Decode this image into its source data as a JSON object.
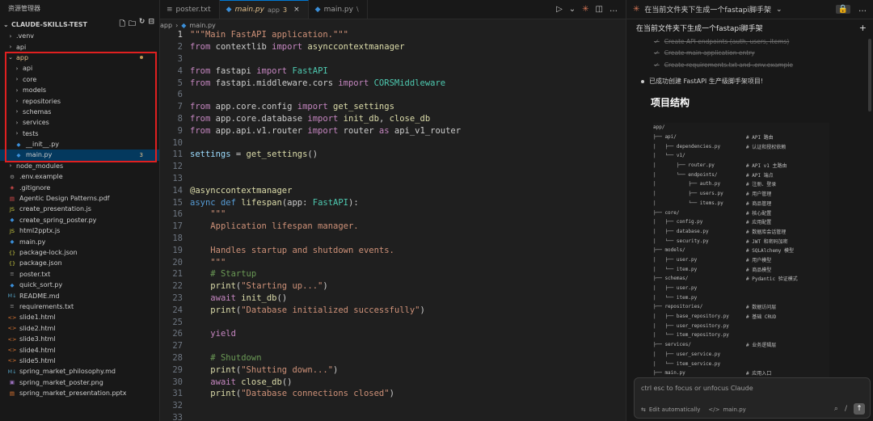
{
  "explorer": {
    "title": "资源管理器",
    "project": "CLAUDE-SKILLS-TEST",
    "items": [
      {
        "name": ".venv",
        "type": "folder",
        "depth": 0
      },
      {
        "name": "api",
        "type": "folder",
        "depth": 0
      },
      {
        "name": "app",
        "type": "folder-open",
        "depth": 0,
        "modified": true
      },
      {
        "name": "api",
        "type": "folder",
        "depth": 1
      },
      {
        "name": "core",
        "type": "folder",
        "depth": 1
      },
      {
        "name": "models",
        "type": "folder",
        "depth": 1
      },
      {
        "name": "repositories",
        "type": "folder",
        "depth": 1
      },
      {
        "name": "schemas",
        "type": "folder",
        "depth": 1
      },
      {
        "name": "services",
        "type": "folder",
        "depth": 1
      },
      {
        "name": "tests",
        "type": "folder",
        "depth": 1
      },
      {
        "name": "__init__.py",
        "type": "py",
        "depth": 1
      },
      {
        "name": "main.py",
        "type": "py",
        "depth": 1,
        "selected": true,
        "badge": "3"
      },
      {
        "name": "node_modules",
        "type": "folder",
        "depth": 0
      },
      {
        "name": ".env.example",
        "type": "env",
        "depth": 0
      },
      {
        "name": ".gitignore",
        "type": "git",
        "depth": 0
      },
      {
        "name": "Agentic Design Patterns.pdf",
        "type": "pdf",
        "depth": 0
      },
      {
        "name": "create_presentation.js",
        "type": "js",
        "depth": 0
      },
      {
        "name": "create_spring_poster.py",
        "type": "py",
        "depth": 0
      },
      {
        "name": "html2pptx.js",
        "type": "js",
        "depth": 0
      },
      {
        "name": "main.py",
        "type": "py",
        "depth": 0
      },
      {
        "name": "package-lock.json",
        "type": "json",
        "depth": 0
      },
      {
        "name": "package.json",
        "type": "json",
        "depth": 0
      },
      {
        "name": "poster.txt",
        "type": "txt",
        "depth": 0
      },
      {
        "name": "quick_sort.py",
        "type": "py",
        "depth": 0
      },
      {
        "name": "README.md",
        "type": "md",
        "depth": 0
      },
      {
        "name": "requirements.txt",
        "type": "txt",
        "depth": 0
      },
      {
        "name": "slide1.html",
        "type": "html",
        "depth": 0
      },
      {
        "name": "slide2.html",
        "type": "html",
        "depth": 0
      },
      {
        "name": "slide3.html",
        "type": "html",
        "depth": 0
      },
      {
        "name": "slide4.html",
        "type": "html",
        "depth": 0
      },
      {
        "name": "slide5.html",
        "type": "html",
        "depth": 0
      },
      {
        "name": "spring_market_philosophy.md",
        "type": "md",
        "depth": 0
      },
      {
        "name": "spring_market_poster.png",
        "type": "png",
        "depth": 0
      },
      {
        "name": "spring_market_presentation.pptx",
        "type": "pptx",
        "depth": 0
      }
    ]
  },
  "tabs": [
    {
      "name": "poster.txt",
      "folder": "",
      "count": "",
      "active": false,
      "icon": "text-file-icon"
    },
    {
      "name": "main.py",
      "folder": "app",
      "count": "3",
      "active": true,
      "icon": "python-icon"
    },
    {
      "name": "main.py",
      "folder": "\\",
      "count": "",
      "active": false,
      "icon": "python-icon"
    }
  ],
  "breadcrumb": {
    "folder": "app",
    "file": "main.py"
  },
  "code": [
    "\"\"\"Main FastAPI application.\"\"\"",
    "from contextlib import asynccontextmanager",
    "",
    "from fastapi import FastAPI",
    "from fastapi.middleware.cors import CORSMiddleware",
    "",
    "from app.core.config import get_settings",
    "from app.core.database import init_db, close_db",
    "from app.api.v1.router import router as api_v1_router",
    "",
    "settings = get_settings()",
    "",
    "",
    "@asynccontextmanager",
    "async def lifespan(app: FastAPI):",
    "    \"\"\"",
    "    Application lifespan manager.",
    "",
    "    Handles startup and shutdown events.",
    "    \"\"\"",
    "    # Startup",
    "    print(\"Starting up...\")",
    "    await init_db()",
    "    print(\"Database initialized successfully\")",
    "",
    "    yield",
    "",
    "    # Shutdown",
    "    print(\"Shutting down...\")",
    "    await close_db()",
    "    print(\"Database connections closed\")",
    "",
    ""
  ],
  "claude": {
    "tab_title": "在当前文件夹下生成一个fastapi脚手架",
    "header": "在当前文件夹下生成一个fastapi脚手架",
    "todos": [
      "Create API endpoints (auth, users, items)",
      "Create main application entry",
      "Create requirements.txt and .env.example"
    ],
    "done_message": "已成功创建 FastAPI 生产级脚手架项目!",
    "section_title": "项目结构",
    "structure": [
      {
        "tree": "app/",
        "comment": ""
      },
      {
        "tree": "├── api/",
        "comment": "# API 路由"
      },
      {
        "tree": "│   ├── dependencies.py",
        "comment": "# 认证和授权依赖"
      },
      {
        "tree": "│   └── v1/",
        "comment": ""
      },
      {
        "tree": "│       ├── router.py",
        "comment": "# API v1 主路由"
      },
      {
        "tree": "│       └── endpoints/",
        "comment": "# API 端点"
      },
      {
        "tree": "│           ├── auth.py",
        "comment": "# 注册、登录"
      },
      {
        "tree": "│           ├── users.py",
        "comment": "# 用户管理"
      },
      {
        "tree": "│           └── items.py",
        "comment": "# 商品管理"
      },
      {
        "tree": "├── core/",
        "comment": "# 核心配置"
      },
      {
        "tree": "│   ├── config.py",
        "comment": "# 应用配置"
      },
      {
        "tree": "│   ├── database.py",
        "comment": "# 数据库会话管理"
      },
      {
        "tree": "│   └── security.py",
        "comment": "# JWT 和密码加密"
      },
      {
        "tree": "├── models/",
        "comment": "# SQLAlchemy 模型"
      },
      {
        "tree": "│   ├── user.py",
        "comment": "# 用户模型"
      },
      {
        "tree": "│   └── item.py",
        "comment": "# 商品模型"
      },
      {
        "tree": "├── schemas/",
        "comment": "# Pydantic 验证模式"
      },
      {
        "tree": "│   ├── user.py",
        "comment": ""
      },
      {
        "tree": "│   └── item.py",
        "comment": ""
      },
      {
        "tree": "├── repositories/",
        "comment": "# 数据访问层"
      },
      {
        "tree": "│   ├── base_repository.py",
        "comment": "# 基础 CRUD"
      },
      {
        "tree": "│   ├── user_repository.py",
        "comment": ""
      },
      {
        "tree": "│   └── item_repository.py",
        "comment": ""
      },
      {
        "tree": "├── services/",
        "comment": "# 业务逻辑层"
      },
      {
        "tree": "│   ├── user_service.py",
        "comment": ""
      },
      {
        "tree": "│   └── item_service.py",
        "comment": ""
      },
      {
        "tree": "├── main.py",
        "comment": "# 应用入口"
      }
    ],
    "input_placeholder": "ctrl esc to focus or unfocus Claude",
    "edit_mode": "Edit automatically",
    "context_file": "main.py"
  }
}
